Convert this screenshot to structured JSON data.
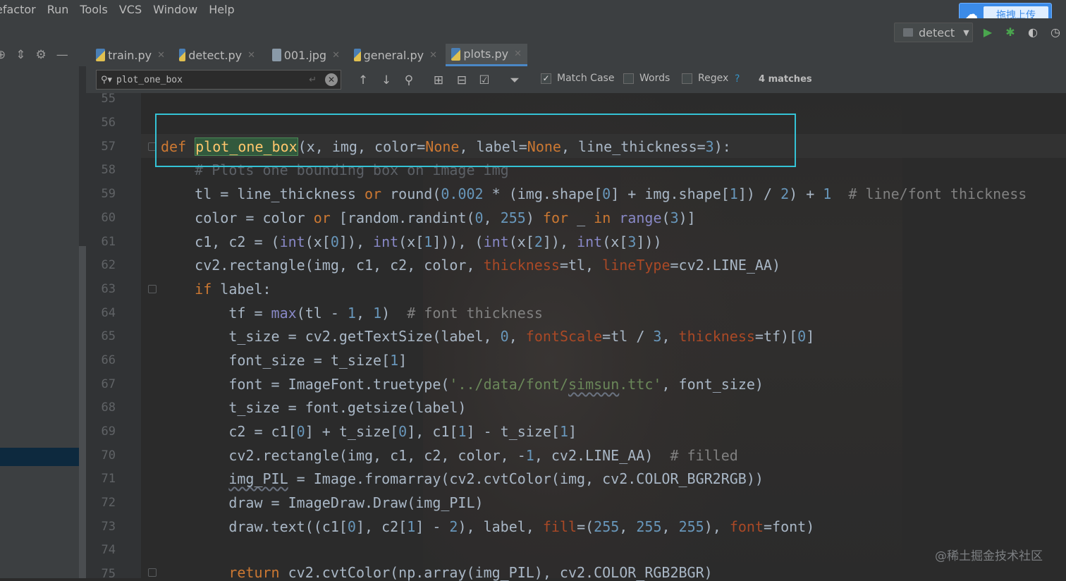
{
  "menubar": [
    "efactor",
    "Run",
    "Tools",
    "VCS",
    "Window",
    "Help"
  ],
  "upload_button": {
    "label": "拖拽上传",
    "icon": "cloud-icon"
  },
  "run_config": {
    "label": "detect"
  },
  "tabs": [
    {
      "label": "train.py",
      "icon": "python-file-icon",
      "active": false
    },
    {
      "label": "detect.py",
      "icon": "python-file-icon",
      "active": false
    },
    {
      "label": "001.jpg",
      "icon": "image-file-icon",
      "active": false
    },
    {
      "label": "general.py",
      "icon": "python-file-icon",
      "active": false
    },
    {
      "label": "plots.py",
      "icon": "python-file-icon",
      "active": true
    }
  ],
  "find": {
    "query": "plot_one_box",
    "match_case": {
      "label": "Match Case",
      "checked": true
    },
    "words": {
      "label": "Words",
      "checked": false
    },
    "regex": {
      "label": "Regex",
      "checked": false
    },
    "help": "?",
    "matches": "4 matches"
  },
  "line_numbers": [
    "55",
    "56",
    "57",
    "58",
    "59",
    "60",
    "61",
    "62",
    "63",
    "64",
    "65",
    "66",
    "67",
    "68",
    "69",
    "70",
    "71",
    "72",
    "73",
    "74",
    "75"
  ],
  "code": {
    "l57_def": "def ",
    "l57_fn": "plot_one_box",
    "l57_a": "(x, img, color=",
    "l57_none1": "None",
    "l57_b": ", label=",
    "l57_none2": "None",
    "l57_c": ", line_thickness=",
    "l57_three": "3",
    "l57_d": "):",
    "l58": "    # Plots one bounding box on image img",
    "l59_a": "    tl = line_thickness ",
    "l59_or": "or",
    "l59_b": " round(",
    "l59_n1": "0.002",
    "l59_c": " * (img.shape[",
    "l59_n2": "0",
    "l59_d": "] + img.shape[",
    "l59_n3": "1",
    "l59_e": "]) / ",
    "l59_n4": "2",
    "l59_f": ") + ",
    "l59_n5": "1",
    "l59_cmt": "  # line/font thickness",
    "l60_a": "    color = color ",
    "l60_or": "or",
    "l60_b": " [random.randint(",
    "l60_n1": "0",
    "l60_c": ", ",
    "l60_n2": "255",
    "l60_d": ") ",
    "l60_for": "for",
    "l60_e": " _ ",
    "l60_in": "in",
    "l60_f": " ",
    "l60_range": "range",
    "l60_g": "(",
    "l60_n3": "3",
    "l60_h": ")]",
    "l61_a": "    c1, c2 = (",
    "l61_int1": "int",
    "l61_b": "(x[",
    "l61_n1": "0",
    "l61_c": "]), ",
    "l61_int2": "int",
    "l61_d": "(x[",
    "l61_n2": "1",
    "l61_e": "])), (",
    "l61_int3": "int",
    "l61_f": "(x[",
    "l61_n3": "2",
    "l61_g": "]), ",
    "l61_int4": "int",
    "l61_h": "(x[",
    "l61_n4": "3",
    "l61_i": "]))",
    "l62_a": "    cv2.rectangle(img, c1, c2, color, ",
    "l62_p1": "thickness",
    "l62_b": "=tl, ",
    "l62_p2": "lineType",
    "l62_c": "=cv2.LINE_AA)",
    "l63_if": "    if",
    "l63_a": " label:",
    "l64_a": "        tf = ",
    "l64_max": "max",
    "l64_b": "(tl - ",
    "l64_n1": "1",
    "l64_c": ", ",
    "l64_n2": "1",
    "l64_d": ")",
    "l64_cmt": "  # font thickness",
    "l65_a": "        t_size = cv2.getTextSize(label, ",
    "l65_n1": "0",
    "l65_b": ", ",
    "l65_p1": "fontScale",
    "l65_c": "=tl / ",
    "l65_n2": "3",
    "l65_d": ", ",
    "l65_p2": "thickness",
    "l65_e": "=tf)[",
    "l65_n3": "0",
    "l65_f": "]",
    "l66_a": "        font_size = t_size[",
    "l66_n1": "1",
    "l66_b": "]",
    "l67_a": "        font = ImageFont.truetype(",
    "l67_s1": "'../data/font/",
    "l67_s2": "simsun",
    "l67_s3": ".ttc'",
    "l67_b": ", font_size)",
    "l68": "        t_size = font.getsize(label)",
    "l69_a": "        c2 = c1[",
    "l69_n1": "0",
    "l69_b": "] + t_size[",
    "l69_n2": "0",
    "l69_c": "], c1[",
    "l69_n3": "1",
    "l69_d": "] - t_size[",
    "l69_n4": "1",
    "l69_e": "]",
    "l70_a": "        cv2.rectangle(img, c1, c2, color, -",
    "l70_n1": "1",
    "l70_b": ", cv2.LINE_AA)",
    "l70_cmt": "  # filled",
    "l71_pre": "        ",
    "l71_var": "img_PIL",
    "l71_a": " = Image.fromarray(cv2.cvtColor(img, cv2.COLOR_BGR2RGB))",
    "l72": "        draw = ImageDraw.Draw(img_PIL)",
    "l73_a": "        draw.text((c1[",
    "l73_n1": "0",
    "l73_b": "], c2[",
    "l73_n2": "1",
    "l73_c": "] - ",
    "l73_n3": "2",
    "l73_d": "), label, ",
    "l73_p1": "fill",
    "l73_e": "=(",
    "l73_n4": "255",
    "l73_f": ", ",
    "l73_n5": "255",
    "l73_g": ", ",
    "l73_n6": "255",
    "l73_h": "), ",
    "l73_p2": "font",
    "l73_i": "=font)",
    "l75_ret": "        return",
    "l75_a": " cv2.cvtColor(np.array(img_PIL), cv2.COLOR_RGB2BGR)"
  },
  "watermark": "@稀土掘金技术社区",
  "colors": {
    "editor_bg": "#2b2b2b",
    "keyword": "#cc7832",
    "number": "#6897bb",
    "string": "#6a8759",
    "comment": "#808080",
    "param": "#aa4926",
    "highlight_box": "#34c3d6",
    "function_name": "#ffc66d"
  }
}
